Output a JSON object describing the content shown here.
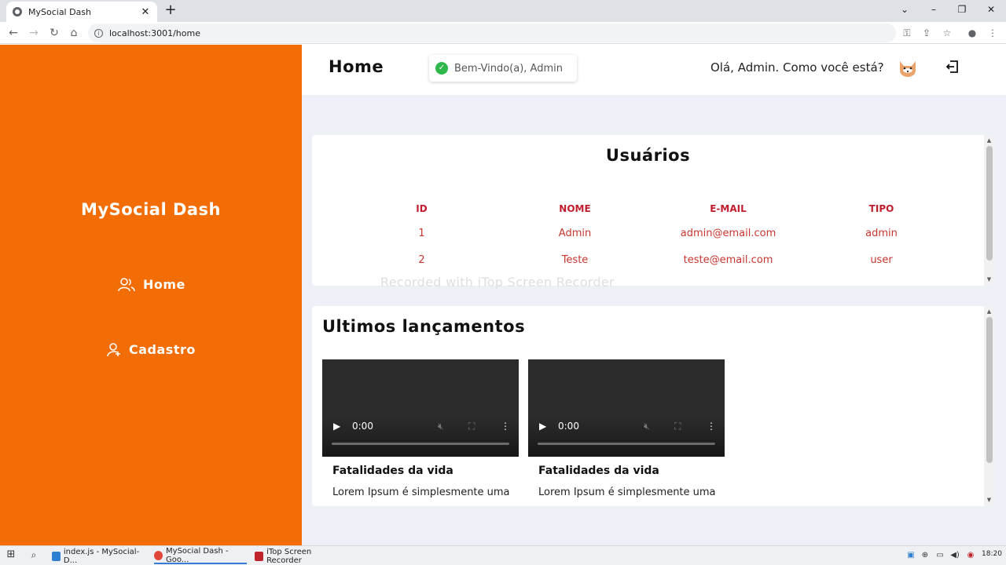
{
  "browser": {
    "tab_title": "MySocial Dash",
    "tab_close": "✕",
    "new_tab": "+",
    "url": "localhost:3001/home"
  },
  "sidebar": {
    "brand": "MySocial Dash",
    "items": [
      {
        "label": "Home",
        "icon": "users-icon"
      },
      {
        "label": "Cadastro",
        "icon": "user-add-icon"
      }
    ]
  },
  "header": {
    "title": "Home",
    "toast": "Bem-Vindo(a), Admin",
    "greeting": "Olá, Admin. Como você está?"
  },
  "users": {
    "title": "Usuários",
    "columns": [
      "ID",
      "NOME",
      "E-MAIL",
      "TIPO"
    ],
    "rows": [
      [
        "1",
        "Admin",
        "admin@email.com",
        "admin"
      ],
      [
        "2",
        "Teste",
        "teste@email.com",
        "user"
      ]
    ]
  },
  "watermark": "Recorded with iTop Screen Recorder",
  "launches": {
    "title": "Ultimos lançamentos",
    "videos": [
      {
        "time": "0:00",
        "title": "Fatalidades da vida",
        "desc": "Lorem Ipsum é simplesmente uma"
      },
      {
        "time": "0:00",
        "title": "Fatalidades da vida",
        "desc": "Lorem Ipsum é simplesmente uma"
      }
    ]
  },
  "taskbar": {
    "items": [
      {
        "label": "index.js - MySocial-D...",
        "color": "#2f80d1"
      },
      {
        "label": "MySocial Dash - Goo...",
        "color": "#e0483a"
      },
      {
        "label": "iTop Screen Recorder",
        "color": "#c0242a"
      }
    ],
    "clock": "18:20"
  },
  "colors": {
    "sidebar": "#f26d05",
    "table_text": "#c01e2e",
    "toast_check": "#2eb84b"
  }
}
